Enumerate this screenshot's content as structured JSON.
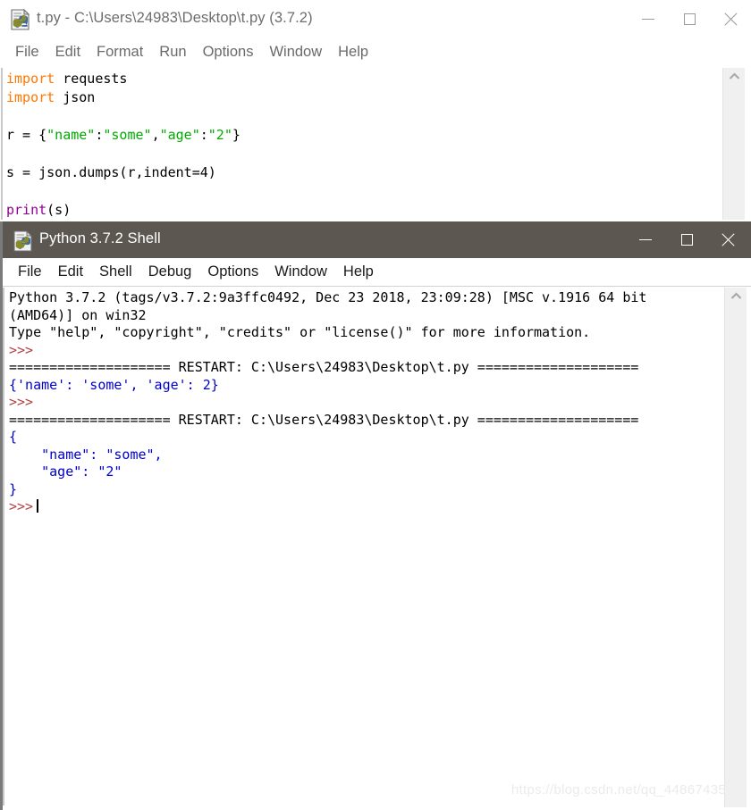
{
  "editor_window": {
    "icon": "python-file-icon",
    "title": "t.py - C:\\Users\\24983\\Desktop\\t.py (3.7.2)",
    "controls": {
      "minimize": "minimize-icon",
      "maximize": "maximize-icon",
      "close": "close-icon"
    },
    "menu": [
      {
        "label": "File"
      },
      {
        "label": "Edit"
      },
      {
        "label": "Format"
      },
      {
        "label": "Run"
      },
      {
        "label": "Options"
      },
      {
        "label": "Window"
      },
      {
        "label": "Help"
      }
    ],
    "code_lines": [
      [
        {
          "t": "import",
          "c": "kw"
        },
        {
          "t": " requests",
          "c": "plain"
        }
      ],
      [
        {
          "t": "import",
          "c": "kw"
        },
        {
          "t": " json",
          "c": "plain"
        }
      ],
      [
        {
          "t": "",
          "c": "plain"
        }
      ],
      [
        {
          "t": "r = {",
          "c": "plain"
        },
        {
          "t": "\"name\"",
          "c": "str"
        },
        {
          "t": ":",
          "c": "plain"
        },
        {
          "t": "\"some\"",
          "c": "str"
        },
        {
          "t": ",",
          "c": "plain"
        },
        {
          "t": "\"age\"",
          "c": "str"
        },
        {
          "t": ":",
          "c": "plain"
        },
        {
          "t": "\"2\"",
          "c": "str"
        },
        {
          "t": "}",
          "c": "plain"
        }
      ],
      [
        {
          "t": "",
          "c": "plain"
        }
      ],
      [
        {
          "t": "s = json.dumps(r,indent=4)",
          "c": "plain"
        }
      ],
      [
        {
          "t": "",
          "c": "plain"
        }
      ],
      [
        {
          "t": "print",
          "c": "builtin"
        },
        {
          "t": "(s)",
          "c": "plain"
        }
      ]
    ],
    "scrollbar": {
      "up_arrow": "chevron-up-icon"
    }
  },
  "shell_window": {
    "icon": "python-shell-icon",
    "title": "Python 3.7.2 Shell",
    "controls": {
      "minimize": "minimize-icon",
      "maximize": "maximize-icon",
      "close": "close-icon"
    },
    "menu": [
      {
        "label": "File"
      },
      {
        "label": "Edit"
      },
      {
        "label": "Shell"
      },
      {
        "label": "Debug"
      },
      {
        "label": "Options"
      },
      {
        "label": "Window"
      },
      {
        "label": "Help"
      }
    ],
    "output_lines": [
      [
        {
          "t": "Python 3.7.2 (tags/v3.7.2:9a3ffc0492, Dec 23 2018, 23:09:28) [MSC v.1916 64 bit",
          "c": "normal"
        }
      ],
      [
        {
          "t": "(AMD64)] on win32",
          "c": "normal"
        }
      ],
      [
        {
          "t": "Type \"help\", \"copyright\", \"credits\" or \"license()\" for more information.",
          "c": "normal"
        }
      ],
      [
        {
          "t": ">>> ",
          "c": "prompt"
        }
      ],
      [
        {
          "t": "==================== RESTART: C:\\Users\\24983\\Desktop\\t.py ====================",
          "c": "normal"
        }
      ],
      [
        {
          "t": "{'name': 'some', 'age': 2}",
          "c": "out"
        }
      ],
      [
        {
          "t": ">>> ",
          "c": "prompt"
        }
      ],
      [
        {
          "t": "==================== RESTART: C:\\Users\\24983\\Desktop\\t.py ====================",
          "c": "normal"
        }
      ],
      [
        {
          "t": "{",
          "c": "out"
        }
      ],
      [
        {
          "t": "    \"name\": \"some\",",
          "c": "out"
        }
      ],
      [
        {
          "t": "    \"age\": \"2\"",
          "c": "out"
        }
      ],
      [
        {
          "t": "}",
          "c": "out"
        }
      ],
      [
        {
          "t": ">>>",
          "c": "prompt"
        },
        {
          "t": "",
          "c": "cursor"
        }
      ]
    ],
    "scrollbar": {
      "up_arrow": "chevron-up-icon"
    }
  },
  "watermark": "https://blog.csdn.net/qq_44867435"
}
